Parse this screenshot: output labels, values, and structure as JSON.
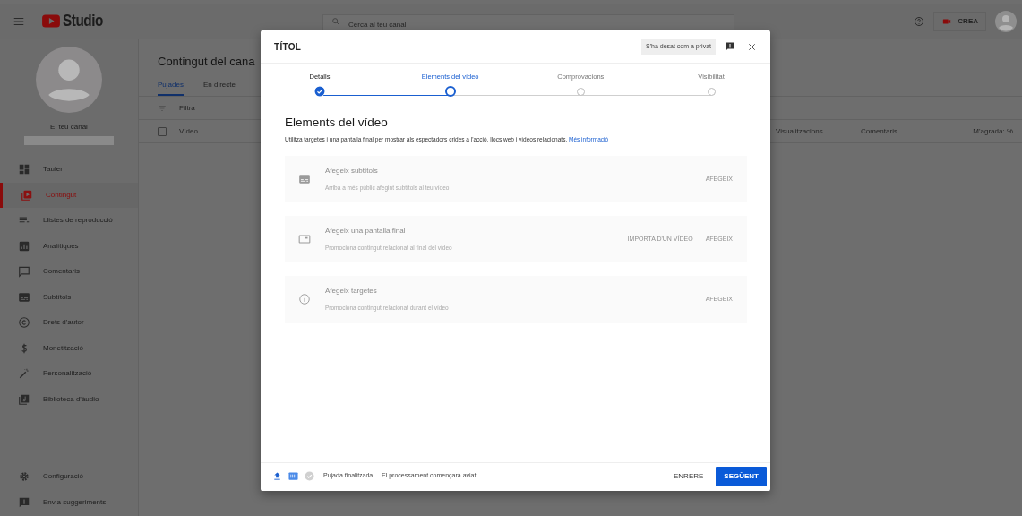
{
  "header": {
    "logo": "Studio",
    "search": {
      "placeholder": "Cerca al teu canal"
    },
    "create_button": "CREA"
  },
  "sidebar": {
    "channel_label": "El teu canal",
    "items": [
      {
        "label": "Tauler",
        "selected": false
      },
      {
        "label": "Contingut",
        "selected": true
      },
      {
        "label": "Llistes de reproducció",
        "selected": false
      },
      {
        "label": "Analítiques",
        "selected": false
      },
      {
        "label": "Comentaris",
        "selected": false
      },
      {
        "label": "Subtítols",
        "selected": false
      },
      {
        "label": "Drets d'autor",
        "selected": false
      },
      {
        "label": "Monetització",
        "selected": false
      },
      {
        "label": "Personalització",
        "selected": false
      },
      {
        "label": "Biblioteca d'àudio",
        "selected": false
      }
    ],
    "bottom_items": [
      "Configuració",
      "Envia suggeriments"
    ]
  },
  "content": {
    "title": "Contingut del cana",
    "tabs": [
      {
        "label": "Pujades",
        "selected": true
      },
      {
        "label": "En directe",
        "selected": false
      }
    ],
    "filter_placeholder": "Filtra",
    "select_all": {
      "checked": false
    },
    "columns": [
      "Vídeo",
      "Visualitzacions",
      "Comentaris",
      "M'agrada: %"
    ]
  },
  "dialog": {
    "title": "TÍTOL",
    "save_status": "S'ha desat com a privat",
    "steps": [
      {
        "label": "Detalls",
        "completed": true,
        "selected": false
      },
      {
        "label": "Elements del vídeo",
        "completed": false,
        "selected": true
      },
      {
        "label": "Comprovacions",
        "completed": false,
        "selected": false
      },
      {
        "label": "Visibilitat",
        "completed": false,
        "selected": false
      }
    ],
    "heading": "Elements del vídeo",
    "description": "Utilitza targetes i una pantalla final per mostrar als espectadors crides a l'acció, llocs web i vídeos relacionats.",
    "link": "Més informació",
    "cards": [
      {
        "title": "Afegeix subtítols",
        "subtitle": "Arriba a més públic afegint subtítols al teu vídeo",
        "actions": [
          "AFEGEIX"
        ]
      },
      {
        "title": "Afegeix una pantalla final",
        "subtitle": "Promociona contingut relacionat al final del vídeo",
        "actions": [
          "IMPORTA D'UN VÍDEO",
          "AFEGEIX"
        ]
      },
      {
        "title": "Afegeix targetes",
        "subtitle": "Promociona contingut relacionat durant el vídeo",
        "actions": [
          "AFEGEIX"
        ]
      }
    ],
    "footer": {
      "status": "Pujada finalitzada ... El processament començarà aviat",
      "back_button": "ENRERE",
      "next_button": "SEGÜENT"
    }
  }
}
